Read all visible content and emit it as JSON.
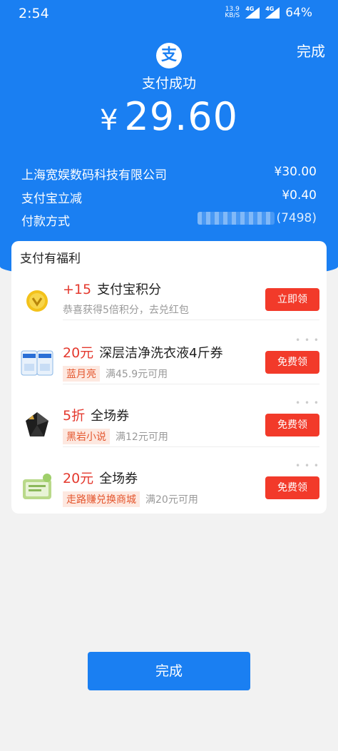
{
  "status_bar": {
    "time": "2:54",
    "speed_value": "13.9",
    "speed_unit": "KB/S",
    "network_1": "4G",
    "network_2": "4G",
    "battery": "64%"
  },
  "header": {
    "done_label": "完成",
    "logo_glyph": "支",
    "title": "支付成功",
    "currency": "¥",
    "amount": "29.60",
    "merchant": "上海宽娱数码科技有限公司",
    "merchant_amount": "¥30.00",
    "discount_label": "支付宝立减",
    "discount_amount": "¥0.40",
    "pay_method_label": "付款方式",
    "pay_method_value": "(7498)"
  },
  "benefits": {
    "title": "支付有福利",
    "items": [
      {
        "highlight": "+15",
        "title": "支付宝积分",
        "subtitle": "恭喜获得5倍积分，去兑红包",
        "badge": "",
        "button": "立即领"
      },
      {
        "highlight": "20元",
        "title": "深层洁净洗衣液4斤券",
        "badge": "蓝月亮",
        "subtitle": "满45.9元可用",
        "button": "免费领"
      },
      {
        "highlight": "5折",
        "title": "全场券",
        "badge": "黑岩小说",
        "subtitle": "满12元可用",
        "button": "免费领"
      },
      {
        "highlight": "20元",
        "title": "全场券",
        "badge": "走路赚兑换商城",
        "subtitle": "满20元可用",
        "button": "免费领"
      }
    ]
  },
  "footer": {
    "done_label": "完成"
  },
  "colors": {
    "brand_blue": "#1a7ff2",
    "button_red": "#f23a2a",
    "highlight_red": "#e4392e"
  }
}
